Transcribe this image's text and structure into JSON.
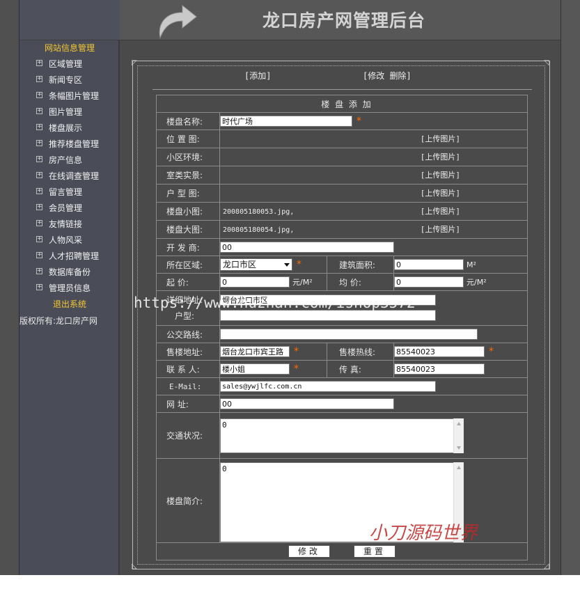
{
  "header": {
    "title": "龙口房产网管理后台"
  },
  "sidebar": {
    "section": "网站信息管理",
    "items": [
      {
        "label": "区域管理"
      },
      {
        "label": "新闻专区"
      },
      {
        "label": "条幅图片管理"
      },
      {
        "label": "图片管理"
      },
      {
        "label": "楼盘展示"
      },
      {
        "label": "推荐楼盘管理"
      },
      {
        "label": "房产信息"
      },
      {
        "label": "在线调查管理"
      },
      {
        "label": "留言管理"
      },
      {
        "label": "会员管理"
      },
      {
        "label": "友情链接"
      },
      {
        "label": "人物风采"
      },
      {
        "label": "人才招聘管理"
      },
      {
        "label": "数据库备份"
      },
      {
        "label": "管理员信息"
      }
    ],
    "plus_glyph": "⊞",
    "logout": "退出系统",
    "copyright": "版权所有:龙口房产网"
  },
  "actions": {
    "add": "[添加]",
    "edit_delete": "[修改  删除]"
  },
  "form": {
    "caption": "楼 盘 添 加",
    "name": {
      "label": "楼盘名称:",
      "value": "时代广场"
    },
    "location_map": {
      "label": "位 置 图:"
    },
    "environment": {
      "label": "小区环境:"
    },
    "interior": {
      "label": "室类实景:"
    },
    "floor_plan": {
      "label": "户 型 图:"
    },
    "thumb": {
      "label": "楼盘小图:",
      "file": "200805180053.jpg,"
    },
    "large": {
      "label": "楼盘大图:",
      "file": "200805180054.jpg,"
    },
    "upload_label": "[上传图片]",
    "developer": {
      "label": "开 发 商:",
      "value": "00"
    },
    "district": {
      "label": "所在区域:",
      "value": "龙口市区"
    },
    "area": {
      "label": "建筑面积:",
      "value": "0",
      "unit": "M²"
    },
    "start_price": {
      "label": "起    价:",
      "value": "0",
      "unit": "元/M²"
    },
    "avg_price": {
      "label": "均    价:",
      "value": "0",
      "unit": "元/M²"
    },
    "address": {
      "label": "详细地址:",
      "value": "烟台龙口市区"
    },
    "unit_type": {
      "label": "户型:",
      "value": ""
    },
    "bus": {
      "label": "公交路线:",
      "value": ""
    },
    "sales_address": {
      "label": "售楼地址:",
      "value": "烟台龙口市宾王路"
    },
    "hotline": {
      "label": "售楼热线:",
      "value": "85540023"
    },
    "contact": {
      "label": "联 系 人:",
      "value": "楼小姐"
    },
    "fax": {
      "label": "传    真:",
      "value": "85540023"
    },
    "email": {
      "label": "E-Mail:",
      "value": "sales@ywjlfc.com.cn"
    },
    "website": {
      "label": "网    址:",
      "value": "00"
    },
    "traffic": {
      "label": "交通状况:",
      "value": "0"
    },
    "intro": {
      "label": "楼盘简介:",
      "value": "0"
    },
    "star": "*",
    "submit": "修改",
    "reset": "重置"
  },
  "watermarks": {
    "url": "https://www.huzhan.com/ishop3572",
    "brand": "小刀源码世界"
  }
}
